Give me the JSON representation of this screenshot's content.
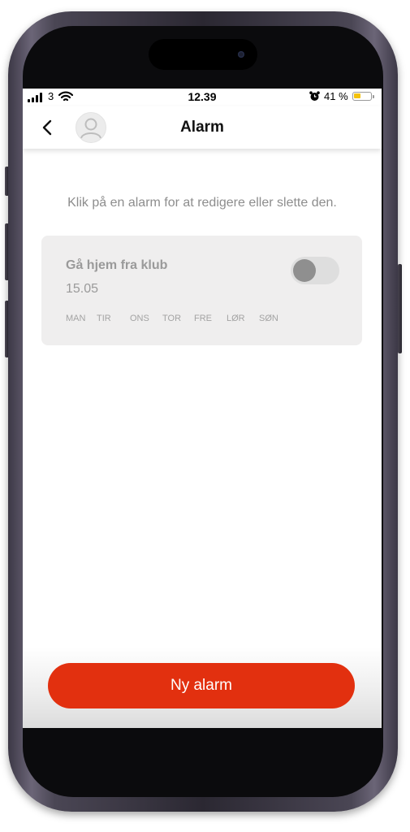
{
  "status_bar": {
    "carrier": "3",
    "time": "12.39",
    "battery_percent": "41 %",
    "battery_level": 0.41,
    "battery_color": "#f4c20d"
  },
  "header": {
    "back_icon": "chevron-left-icon",
    "avatar_icon": "user-avatar-icon",
    "title": "Alarm"
  },
  "instruction": "Klik på en alarm for at redigere eller slette den.",
  "alarms": [
    {
      "name": "Gå hjem fra klub",
      "time": "15.05",
      "enabled": false,
      "days": [
        "MAN",
        "TIR",
        "ONS",
        "TOR",
        "FRE",
        "LØR",
        "SØN"
      ]
    }
  ],
  "new_alarm_button": "Ny alarm",
  "colors": {
    "accent": "#e2300f",
    "card_background": "#efeeee",
    "muted_text": "#9a9a9a"
  }
}
